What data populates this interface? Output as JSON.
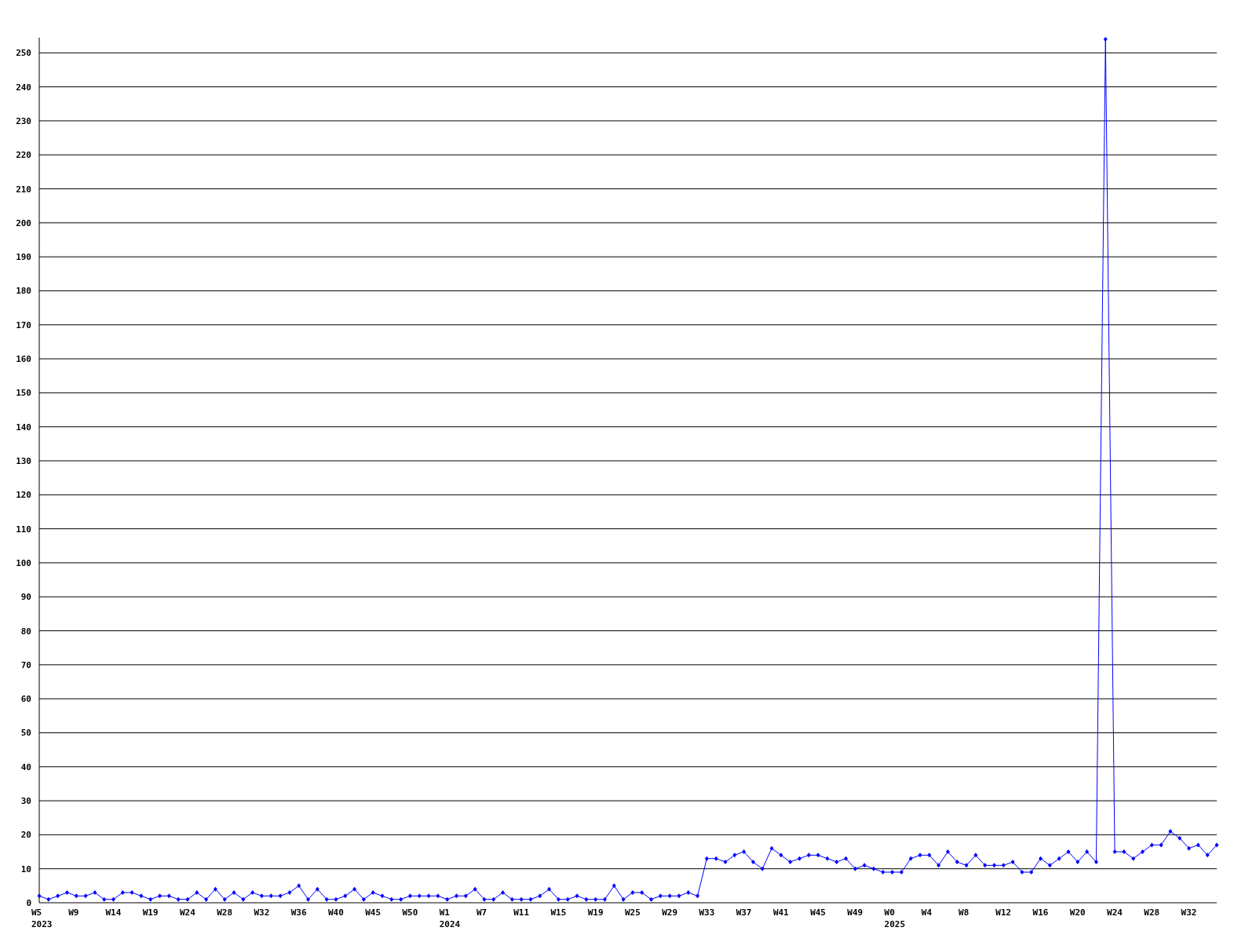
{
  "chart_data": {
    "type": "line",
    "grid": true,
    "categories": [
      "W5\n2023",
      null,
      null,
      null,
      "W9",
      null,
      null,
      null,
      "W14",
      null,
      null,
      null,
      "W19",
      null,
      null,
      null,
      "W24",
      null,
      null,
      null,
      "W28",
      null,
      null,
      null,
      "W32",
      null,
      null,
      null,
      "W36",
      null,
      null,
      null,
      "W40",
      null,
      null,
      null,
      "W45",
      null,
      null,
      null,
      "W50",
      null,
      null,
      null,
      "W1\n2024",
      null,
      null,
      null,
      "W7",
      null,
      null,
      null,
      "W11",
      null,
      null,
      null,
      "W15",
      null,
      null,
      null,
      "W19",
      null,
      null,
      null,
      "W25",
      null,
      null,
      null,
      "W29",
      null,
      null,
      null,
      "W33",
      null,
      null,
      null,
      "W37",
      null,
      null,
      null,
      "W41",
      null,
      null,
      null,
      "W45",
      null,
      null,
      null,
      "W49",
      null,
      null,
      null,
      "W0\n2025",
      null,
      null,
      null,
      "W4",
      null,
      null,
      null,
      "W8",
      null,
      null,
      null,
      "W12",
      null,
      null,
      null,
      "W16",
      null,
      null,
      null,
      "W20",
      null,
      null,
      null,
      "W24",
      null,
      null,
      null,
      "W28",
      null,
      null,
      null,
      "W32",
      null,
      null,
      null
    ],
    "series": [
      {
        "color": "#0000ff",
        "marker": "diamond",
        "values": [
          2,
          1,
          2,
          3,
          2,
          2,
          3,
          1,
          1,
          3,
          3,
          2,
          1,
          2,
          2,
          1,
          1,
          3,
          1,
          4,
          1,
          3,
          1,
          3,
          2,
          2,
          2,
          3,
          5,
          1,
          4,
          1,
          1,
          2,
          4,
          1,
          3,
          2,
          1,
          1,
          2,
          2,
          2,
          2,
          1,
          2,
          2,
          4,
          1,
          1,
          3,
          1,
          1,
          1,
          2,
          4,
          1,
          1,
          2,
          1,
          1,
          1,
          5,
          1,
          3,
          3,
          1,
          2,
          2,
          2,
          3,
          2,
          13,
          13,
          12,
          14,
          15,
          12,
          10,
          16,
          14,
          12,
          13,
          14,
          14,
          13,
          12,
          13,
          10,
          11,
          10,
          9,
          9,
          9,
          13,
          14,
          14,
          11,
          15,
          12,
          11,
          14,
          11,
          11,
          11,
          12,
          9,
          9,
          13,
          11,
          13,
          15,
          12,
          15,
          12,
          254,
          15,
          15,
          13,
          15,
          17,
          17,
          21,
          19,
          16,
          17,
          14,
          17
        ]
      }
    ],
    "ylim": [
      0,
      254
    ],
    "yticks": [
      0,
      10,
      20,
      30,
      40,
      50,
      60,
      70,
      80,
      90,
      100,
      110,
      120,
      130,
      140,
      150,
      160,
      170,
      180,
      190,
      200,
      210,
      220,
      230,
      240,
      250
    ]
  }
}
